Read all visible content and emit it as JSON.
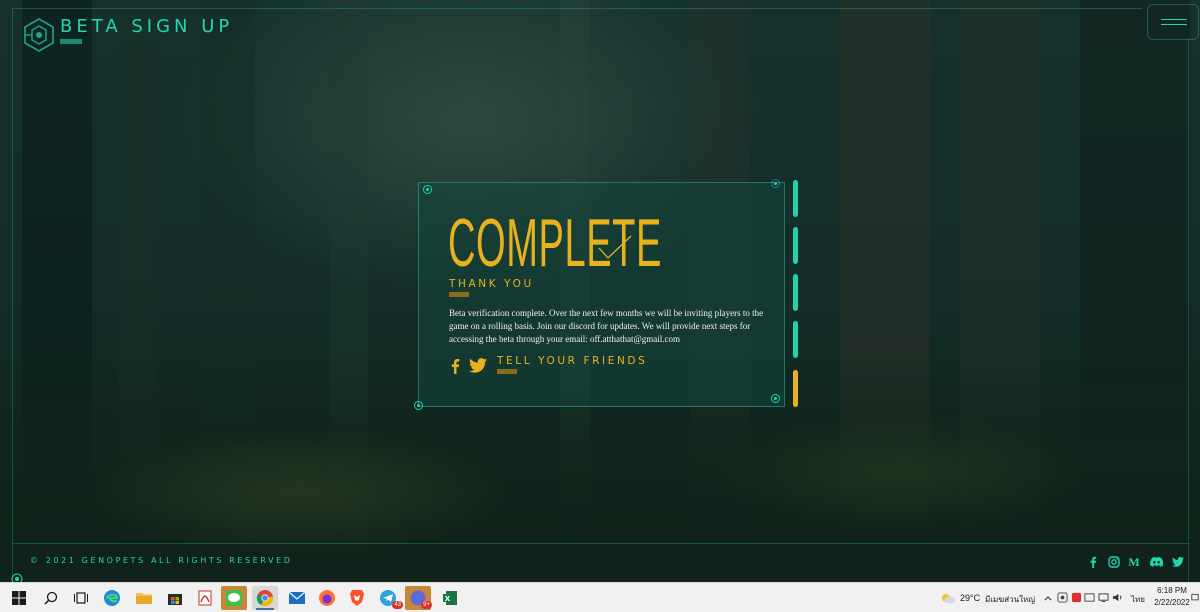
{
  "header": {
    "title": "BETA SIGN UP",
    "logo_icon": "hexagon-logo-icon",
    "menu_icon": "hamburger-menu-icon"
  },
  "card": {
    "title": "COMPLETE",
    "title_icon": "checkmark-icon",
    "subtitle": "THANK YOU",
    "message": "Beta verification complete. Over the next few months we will be inviting players to the game on a rolling basis. Join our discord for updates. We will provide next steps for accessing the beta through your email: off.atthathat@gmail.com",
    "share_label": "TELL YOUR FRIENDS",
    "share_icons": [
      "facebook-icon",
      "twitter-icon"
    ]
  },
  "progress": {
    "segments_total": 5,
    "segments_complete": 4,
    "colors": {
      "complete": "#1fd3ad",
      "current": "#e8b21d"
    }
  },
  "footer": {
    "copyright": "© 2021 GENOPETS ALL RIGHTS RESERVED",
    "social_icons": [
      "facebook-icon",
      "instagram-icon",
      "medium-icon",
      "discord-icon",
      "twitter-icon"
    ],
    "medium_letter": "M"
  },
  "colors": {
    "accent_teal": "#22d6b0",
    "accent_gold": "#e8b21d",
    "background": "#1a3530"
  },
  "taskbar": {
    "apps": [
      "start-icon",
      "search-icon",
      "task-view-icon",
      "edge-icon",
      "file-explorer-icon",
      "store-icon",
      "pdf-icon",
      "line-icon",
      "chrome-icon",
      "mail-icon",
      "firefox-icon",
      "brave-icon",
      "telegram-icon",
      "app-icon",
      "excel-icon"
    ],
    "telegram_badge": "43",
    "app_badge": "9+",
    "weather": "29°C",
    "weather_desc": "มีเมฆส่วนใหญ่",
    "language": "ไทย",
    "time": "6:18 PM",
    "date": "2/22/2022"
  }
}
